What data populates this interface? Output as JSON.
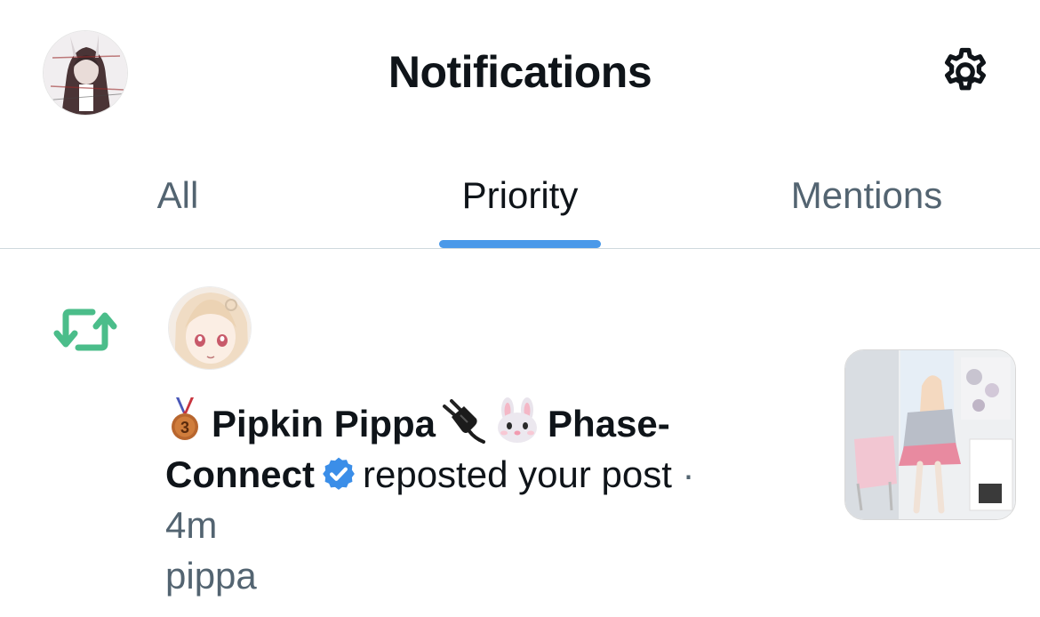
{
  "header": {
    "title": "Notifications",
    "avatar_icon": "user-avatar",
    "settings_icon": "gear-icon"
  },
  "tabs": [
    {
      "label": "All",
      "active": false
    },
    {
      "label": "Priority",
      "active": true
    },
    {
      "label": "Mentions",
      "active": false
    }
  ],
  "colors": {
    "accent": "#4a99e9",
    "repost_green": "#4bbd8a",
    "text_primary": "#0f1419",
    "text_secondary": "#536471",
    "verified": "#3b8ee8"
  },
  "notification": {
    "type_icon": "repost-icon",
    "user_name_part1": "Pipkin Pippa",
    "user_name_part2": "Phase-",
    "user_name_part3": "Connect",
    "name_emojis": [
      "3rd-place-medal",
      "electric-plug",
      "rabbit-face"
    ],
    "verified": true,
    "action": "reposted your post",
    "separator": "·",
    "time": "4m",
    "post_preview": "pippa",
    "has_media_thumbnail": true
  }
}
